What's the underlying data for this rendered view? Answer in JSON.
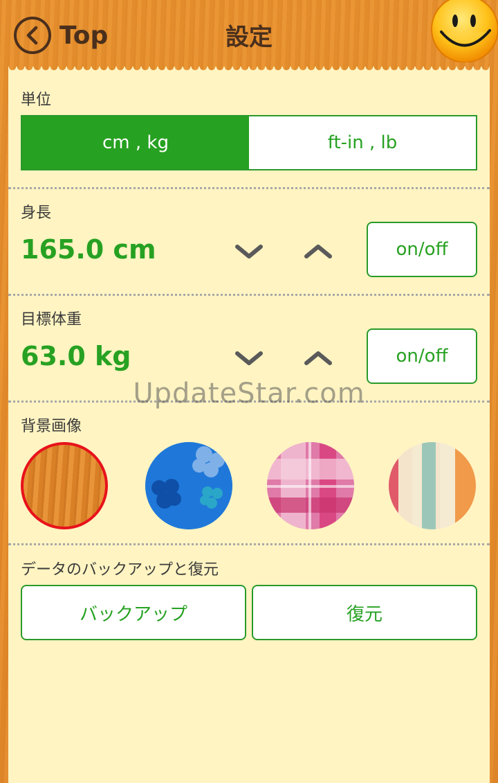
{
  "header": {
    "back_label": "Top",
    "title": "設定"
  },
  "units": {
    "label": "単位",
    "options": [
      "cm , kg",
      "ft-in , lb"
    ],
    "selected": "cm , kg"
  },
  "height": {
    "label": "身長",
    "value": "165.0 cm",
    "toggle_label": "on/off"
  },
  "target_weight": {
    "label": "目標体重",
    "value": "63.0 kg",
    "toggle_label": "on/off"
  },
  "background": {
    "label": "背景画像",
    "options": [
      "wood",
      "blue-flowers",
      "pink-check",
      "stripes"
    ],
    "selected": "wood",
    "selected_border_color": "#e8121b"
  },
  "backup": {
    "label": "データのバックアップと復元",
    "backup_button": "バックアップ",
    "restore_button": "復元"
  },
  "watermark": "UpdateStar.com",
  "colors": {
    "accent": "#27a122",
    "panel": "#fff4c2",
    "wood": "#e3892a",
    "header_text": "#4a2f1c"
  }
}
